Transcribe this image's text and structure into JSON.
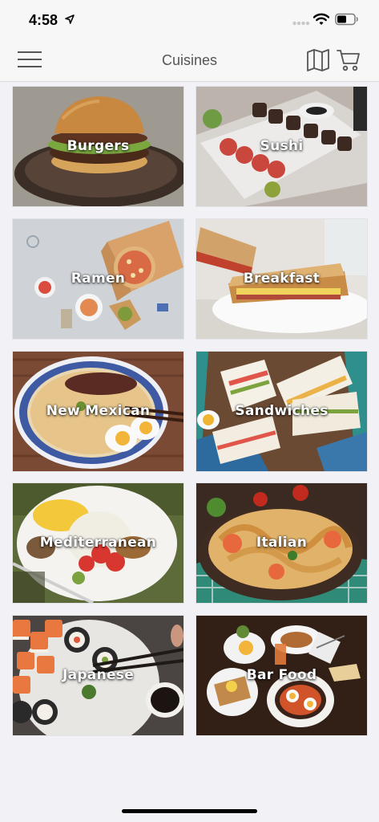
{
  "status_bar": {
    "time": "4:58",
    "icons": [
      "location-arrow-icon",
      "cellular-signal-icon",
      "wifi-icon",
      "battery-icon"
    ]
  },
  "nav": {
    "title": "Cuisines",
    "icons": [
      "menu-icon",
      "map-icon",
      "cart-icon"
    ]
  },
  "cuisines": [
    {
      "label": "Burgers"
    },
    {
      "label": "Sushi"
    },
    {
      "label": "Ramen"
    },
    {
      "label": "Breakfast"
    },
    {
      "label": "New Mexican"
    },
    {
      "label": "Sandwiches"
    },
    {
      "label": "Mediterranean"
    },
    {
      "label": "Italian"
    },
    {
      "label": "Japanese"
    },
    {
      "label": "Bar Food"
    }
  ],
  "colors": {
    "background": "#f2f1f6",
    "bar": "#f7f7f7",
    "title": "#555555",
    "tile_label": "#ffffff"
  }
}
